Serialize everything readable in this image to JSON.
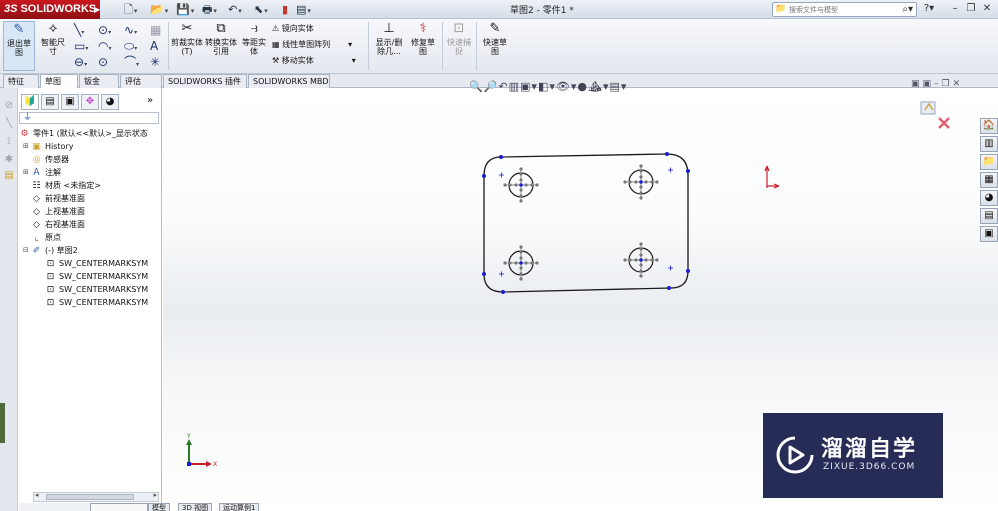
{
  "app": {
    "brand_ds": "3S",
    "brand_name": "SOLIDWORKS",
    "document_title": "草图2 - 零件1 *",
    "search_placeholder": "搜索文件与模型"
  },
  "command_manager": {
    "exit_sketch": "退出草图",
    "smart_dimension": "智能尺寸",
    "trim_entities": "剪裁实体(T)",
    "convert_entities": "转换实体引用",
    "offset_entities": "等距实体",
    "mirror_entities": "镜向实体",
    "linear_pattern": "线性草图阵列",
    "move_entities": "移动实体",
    "display_delete_relations": "显示/删除几...",
    "repair_sketch": "修复草图",
    "quick_snaps": "快速捕捉",
    "rapid_sketch": "快速草图"
  },
  "tabs": [
    "特征",
    "草图",
    "钣金",
    "评估",
    "SOLIDWORKS 插件",
    "SOLIDWORKS MBD"
  ],
  "active_tab": "草图",
  "tree": {
    "part": "零件1 (默认<<默认>_显示状态",
    "history": "History",
    "sensors": "传感器",
    "annotations": "注解",
    "material": "材质 <未指定>",
    "front_plane": "前视基准面",
    "top_plane": "上视基准面",
    "right_plane": "右视基准面",
    "origin": "原点",
    "sketch": "(-) 草图2",
    "children": [
      "SW_CENTERMARKSYM",
      "SW_CENTERMARKSYM",
      "SW_CENTERMARKSYM",
      "SW_CENTERMARKSYM"
    ]
  },
  "bottom_tabs": [
    "模型",
    "3D 视图",
    "运动算例1"
  ],
  "watermark": {
    "title": "溜溜自学",
    "url": "ZIXUE.3D66.COM"
  },
  "colors": {
    "brand_red": "#c8171e",
    "sketch_line": "#1a1a1a",
    "sketch_point": "#1a1ad6",
    "origin_red": "#d0202a",
    "watermark_bg": "#272c57"
  }
}
